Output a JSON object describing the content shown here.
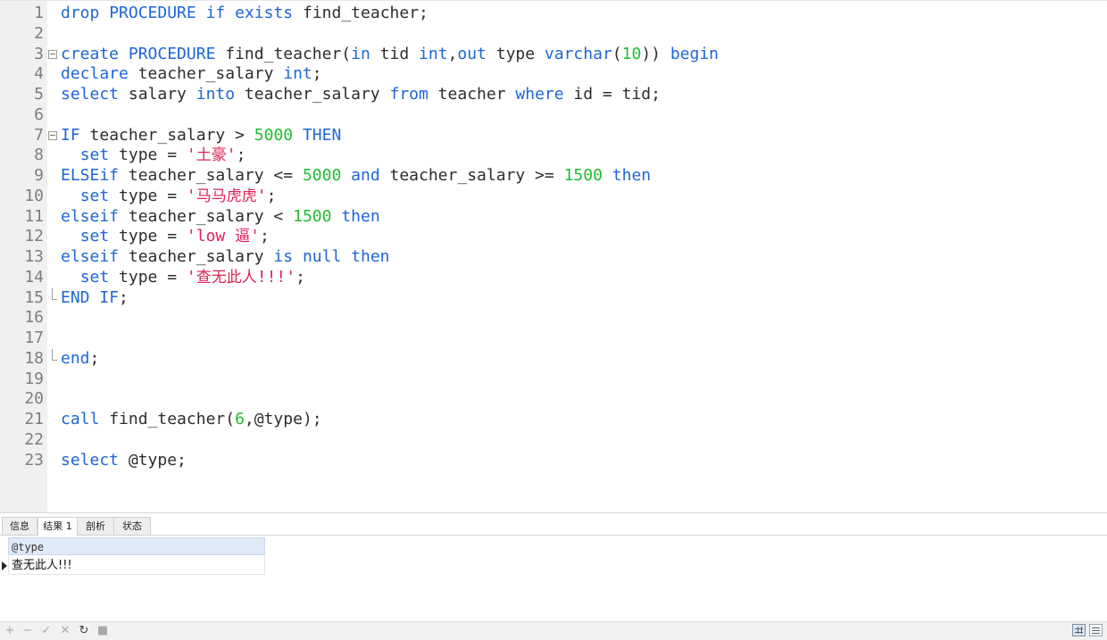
{
  "editor": {
    "lines": [
      {
        "num": "1",
        "tokens": [
          [
            "kw",
            "drop"
          ],
          [
            "t",
            " "
          ],
          [
            "kw",
            "PROCEDURE"
          ],
          [
            "t",
            " "
          ],
          [
            "kw",
            "if"
          ],
          [
            "t",
            " "
          ],
          [
            "kw",
            "exists"
          ],
          [
            "t",
            " find_teacher;"
          ]
        ]
      },
      {
        "num": "2",
        "tokens": []
      },
      {
        "num": "3",
        "fold": "start",
        "tokens": [
          [
            "kw",
            "create"
          ],
          [
            "t",
            " "
          ],
          [
            "kw",
            "PROCEDURE"
          ],
          [
            "t",
            " find_teacher("
          ],
          [
            "kw",
            "in"
          ],
          [
            "t",
            " tid "
          ],
          [
            "kw",
            "int"
          ],
          [
            "t",
            ","
          ],
          [
            "kw",
            "out"
          ],
          [
            "t",
            " type "
          ],
          [
            "kw",
            "varchar"
          ],
          [
            "t",
            "("
          ],
          [
            "num",
            "10"
          ],
          [
            "t",
            ")) "
          ],
          [
            "kw",
            "begin"
          ]
        ]
      },
      {
        "num": "4",
        "tokens": [
          [
            "kw",
            "declare"
          ],
          [
            "t",
            " teacher_salary "
          ],
          [
            "kw",
            "int"
          ],
          [
            "t",
            ";"
          ]
        ]
      },
      {
        "num": "5",
        "tokens": [
          [
            "kw",
            "select"
          ],
          [
            "t",
            " salary "
          ],
          [
            "kw",
            "into"
          ],
          [
            "t",
            " teacher_salary "
          ],
          [
            "kw",
            "from"
          ],
          [
            "t",
            " teacher "
          ],
          [
            "kw",
            "where"
          ],
          [
            "t",
            " id = tid;"
          ]
        ]
      },
      {
        "num": "6",
        "tokens": []
      },
      {
        "num": "7",
        "fold": "start",
        "tokens": [
          [
            "kw",
            "IF"
          ],
          [
            "t",
            " teacher_salary > "
          ],
          [
            "num",
            "5000"
          ],
          [
            "t",
            " "
          ],
          [
            "kw",
            "THEN"
          ]
        ]
      },
      {
        "num": "8",
        "tokens": [
          [
            "t",
            "  "
          ],
          [
            "kw",
            "set"
          ],
          [
            "t",
            " type = "
          ],
          [
            "str",
            "'"
          ],
          [
            "strcn",
            "土豪"
          ],
          [
            "str",
            "'"
          ],
          [
            "t",
            ";"
          ]
        ]
      },
      {
        "num": "9",
        "tokens": [
          [
            "kw",
            "ELSEif"
          ],
          [
            "t",
            " teacher_salary <= "
          ],
          [
            "num",
            "5000"
          ],
          [
            "t",
            " "
          ],
          [
            "kw",
            "and"
          ],
          [
            "t",
            " teacher_salary >= "
          ],
          [
            "num",
            "1500"
          ],
          [
            "t",
            " "
          ],
          [
            "kw",
            "then"
          ]
        ]
      },
      {
        "num": "10",
        "tokens": [
          [
            "t",
            "  "
          ],
          [
            "kw",
            "set"
          ],
          [
            "t",
            " type = "
          ],
          [
            "str",
            "'"
          ],
          [
            "strcn",
            "马马虎虎"
          ],
          [
            "str",
            "'"
          ],
          [
            "t",
            ";"
          ]
        ]
      },
      {
        "num": "11",
        "tokens": [
          [
            "kw",
            "elseif"
          ],
          [
            "t",
            " teacher_salary < "
          ],
          [
            "num",
            "1500"
          ],
          [
            "t",
            " "
          ],
          [
            "kw",
            "then"
          ]
        ]
      },
      {
        "num": "12",
        "tokens": [
          [
            "t",
            "  "
          ],
          [
            "kw",
            "set"
          ],
          [
            "t",
            " type = "
          ],
          [
            "str",
            "'low "
          ],
          [
            "strcn",
            "逼"
          ],
          [
            "str",
            "'"
          ],
          [
            "t",
            ";"
          ]
        ]
      },
      {
        "num": "13",
        "tokens": [
          [
            "kw",
            "elseif"
          ],
          [
            "t",
            " teacher_salary "
          ],
          [
            "kw",
            "is"
          ],
          [
            "t",
            " "
          ],
          [
            "kw",
            "null"
          ],
          [
            "t",
            " "
          ],
          [
            "kw",
            "then"
          ]
        ]
      },
      {
        "num": "14",
        "tokens": [
          [
            "t",
            "  "
          ],
          [
            "kw",
            "set"
          ],
          [
            "t",
            " type = "
          ],
          [
            "str",
            "'"
          ],
          [
            "strcn",
            "查无此人"
          ],
          [
            "str",
            "!!!'"
          ],
          [
            "t",
            ";"
          ]
        ]
      },
      {
        "num": "15",
        "fold": "end",
        "tokens": [
          [
            "kw",
            "END"
          ],
          [
            "t",
            " "
          ],
          [
            "kw",
            "IF"
          ],
          [
            "t",
            ";"
          ]
        ]
      },
      {
        "num": "16",
        "tokens": []
      },
      {
        "num": "17",
        "tokens": []
      },
      {
        "num": "18",
        "fold": "end",
        "tokens": [
          [
            "kw",
            "end"
          ],
          [
            "t",
            ";"
          ]
        ]
      },
      {
        "num": "19",
        "tokens": []
      },
      {
        "num": "20",
        "tokens": []
      },
      {
        "num": "21",
        "tokens": [
          [
            "kw",
            "call"
          ],
          [
            "t",
            " find_teacher("
          ],
          [
            "num",
            "6"
          ],
          [
            "t",
            ",@type);"
          ]
        ]
      },
      {
        "num": "22",
        "tokens": []
      },
      {
        "num": "23",
        "tokens": [
          [
            "kw",
            "select"
          ],
          [
            "t",
            " @type;"
          ]
        ]
      }
    ]
  },
  "result_tabs": [
    "信息",
    "结果 1",
    "剖析",
    "状态"
  ],
  "active_tab": "结果 1",
  "result": {
    "column_header": "@type",
    "cell_value": "查无此人!!!"
  },
  "status_bar": {
    "icons": [
      "plus-icon",
      "minus-icon",
      "check-icon",
      "cross-icon",
      "refresh-icon",
      "stop-icon"
    ],
    "glyphs": [
      "+",
      "−",
      "✓",
      "✕",
      "↻",
      "■"
    ]
  },
  "colors": {
    "keyword": "#1e66d6",
    "number": "#22bb33",
    "string": "#dd2255",
    "text": "#2d2d2d",
    "line_number": "#7d7d7d"
  }
}
